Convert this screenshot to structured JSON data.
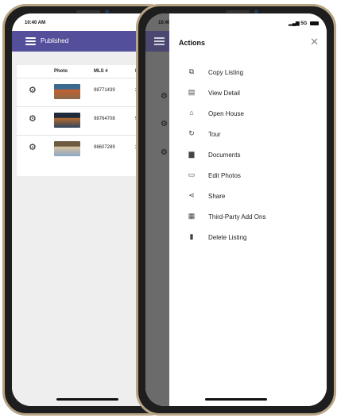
{
  "status": {
    "time": "10:40 AM",
    "network": "5G"
  },
  "left_screen": {
    "header_title": "Published",
    "columns": [
      "Photo",
      "MLS #",
      "P"
    ],
    "rows": [
      {
        "mls": "98771439",
        "p": "2",
        "thumb_colors": [
          "#8a6a4a",
          "#c65f2e",
          "#3b6a8f"
        ]
      },
      {
        "mls": "98764708",
        "p": "9",
        "thumb_colors": [
          "#2f4560",
          "#b86a2c",
          "#1d2b3a"
        ]
      },
      {
        "mls": "98607289",
        "p": "2",
        "thumb_colors": [
          "#8da8c8",
          "#d9c3a0",
          "#6d5a40"
        ]
      }
    ]
  },
  "actions_sheet": {
    "title": "Actions",
    "close_icon": "close-icon",
    "items": [
      {
        "label": "Copy Listing",
        "icon": "copy-icon",
        "glyph": "⧉"
      },
      {
        "label": "View Detail",
        "icon": "view-detail-icon",
        "glyph": "▤"
      },
      {
        "label": "Open House",
        "icon": "house-icon",
        "glyph": "⌂"
      },
      {
        "label": "Tour",
        "icon": "tour-icon",
        "glyph": "↻"
      },
      {
        "label": "Documents",
        "icon": "document-icon",
        "glyph": "▆"
      },
      {
        "label": "Edit Photos",
        "icon": "photo-icon",
        "glyph": "▭"
      },
      {
        "label": "Share",
        "icon": "share-icon",
        "glyph": "⋖"
      },
      {
        "label": "Third-Party Add Ons",
        "icon": "add-ons-icon",
        "glyph": "▦"
      },
      {
        "label": "Delete Listing",
        "icon": "trash-icon",
        "glyph": "▮"
      }
    ]
  },
  "colors": {
    "header": "#544f9b",
    "frame": "#b8a585"
  }
}
